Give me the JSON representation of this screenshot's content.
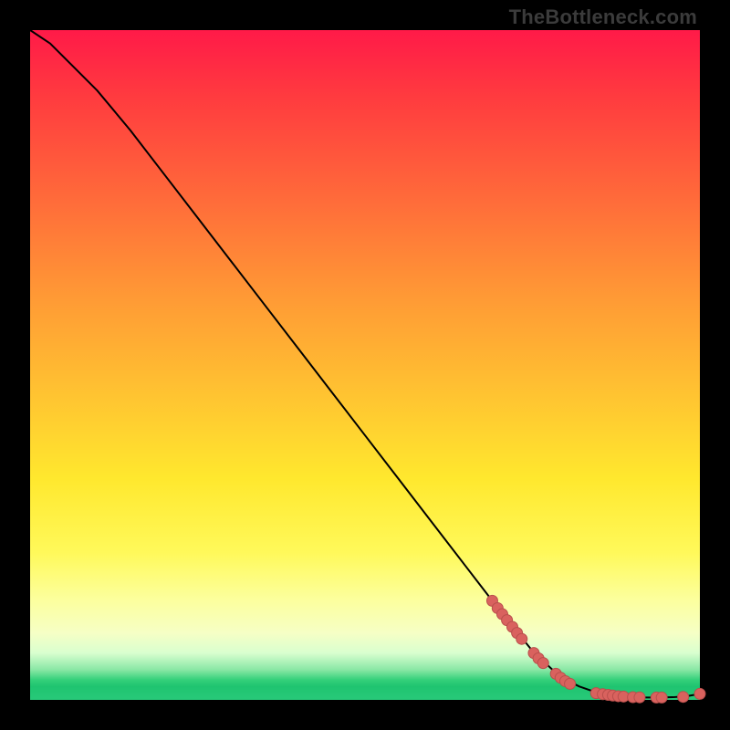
{
  "watermark": "TheBottleneck.com",
  "chart_data": {
    "type": "line",
    "title": "",
    "xlabel": "",
    "ylabel": "",
    "xlim": [
      0,
      100
    ],
    "ylim": [
      0,
      100
    ],
    "grid": false,
    "legend": false,
    "series": [
      {
        "name": "curve",
        "x": [
          0,
          3,
          6,
          10,
          15,
          20,
          25,
          30,
          35,
          40,
          45,
          50,
          55,
          60,
          65,
          70,
          73,
          75,
          78,
          80,
          82,
          84,
          85,
          86,
          88,
          90,
          92,
          94,
          96,
          98,
          100
        ],
        "y": [
          100,
          98,
          95,
          91,
          85,
          78.5,
          72,
          65.5,
          59,
          52.5,
          46,
          39.5,
          33,
          26.5,
          20,
          13.5,
          9.8,
          7.3,
          4.5,
          3.0,
          2.0,
          1.3,
          1.0,
          0.8,
          0.55,
          0.4,
          0.35,
          0.35,
          0.4,
          0.55,
          0.9
        ]
      }
    ],
    "markers": [
      {
        "x": 69.0,
        "y": 14.8
      },
      {
        "x": 69.8,
        "y": 13.7
      },
      {
        "x": 70.5,
        "y": 12.8
      },
      {
        "x": 71.2,
        "y": 11.9
      },
      {
        "x": 72.0,
        "y": 10.9
      },
      {
        "x": 72.7,
        "y": 10.0
      },
      {
        "x": 73.4,
        "y": 9.1
      },
      {
        "x": 75.2,
        "y": 7.0
      },
      {
        "x": 75.9,
        "y": 6.2
      },
      {
        "x": 76.6,
        "y": 5.5
      },
      {
        "x": 78.5,
        "y": 3.9
      },
      {
        "x": 79.2,
        "y": 3.3
      },
      {
        "x": 79.9,
        "y": 2.8
      },
      {
        "x": 80.6,
        "y": 2.4
      },
      {
        "x": 84.5,
        "y": 1.0
      },
      {
        "x": 85.5,
        "y": 0.85
      },
      {
        "x": 86.3,
        "y": 0.75
      },
      {
        "x": 87.0,
        "y": 0.65
      },
      {
        "x": 87.8,
        "y": 0.55
      },
      {
        "x": 88.6,
        "y": 0.5
      },
      {
        "x": 90.0,
        "y": 0.4
      },
      {
        "x": 91.0,
        "y": 0.38
      },
      {
        "x": 93.5,
        "y": 0.35
      },
      {
        "x": 94.3,
        "y": 0.35
      },
      {
        "x": 97.5,
        "y": 0.45
      },
      {
        "x": 100.0,
        "y": 0.9
      }
    ],
    "marker_radius_px": 6
  }
}
